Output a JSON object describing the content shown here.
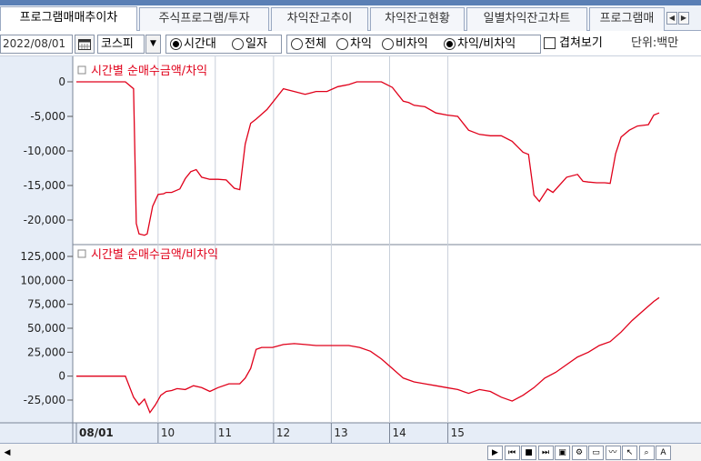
{
  "tabs": [
    {
      "label": "프로그램매매추이차",
      "active": true
    },
    {
      "label": "주식프로그램/투자",
      "active": false
    },
    {
      "label": "차익잔고추이",
      "active": false
    },
    {
      "label": "차익잔고현황",
      "active": false
    },
    {
      "label": "일별차익잔고차트",
      "active": false
    },
    {
      "label": "프로그램매",
      "active": false
    }
  ],
  "tab_scroll": {
    "left": "◀",
    "right": "▶"
  },
  "toolbar": {
    "date": "2022/08/01",
    "calendar_icon": "calendar-icon",
    "market": "코스피",
    "dropdown_arrow": "▼",
    "period_options": [
      {
        "label": "시간대",
        "selected": true
      },
      {
        "label": "일자",
        "selected": false
      }
    ],
    "type_options": [
      {
        "label": "전체",
        "selected": false
      },
      {
        "label": "차익",
        "selected": false
      },
      {
        "label": "비차익",
        "selected": false
      },
      {
        "label": "차익/비차익",
        "selected": true
      }
    ],
    "overlay_label": "겹쳐보기",
    "overlay_checked": false,
    "unit": "단위:백만"
  },
  "colors": {
    "line": "#e0001a",
    "pane_bg": "#e6edf7",
    "grid": "#c8cfda"
  },
  "chart_data": [
    {
      "type": "line",
      "title": "시간별 순매수금액/차익",
      "ylim": [
        -22000,
        0
      ],
      "yticks": [
        "0",
        "-5,000",
        "-10,000",
        "-15,000",
        "-20,000"
      ],
      "ytick_values": [
        0,
        -5000,
        -10000,
        -15000,
        -20000
      ],
      "x": [
        0,
        0.12,
        0.15,
        0.2,
        0.3,
        0.45,
        0.6,
        0.75,
        0.9,
        1.05,
        1.1,
        1.15,
        1.25,
        1.3,
        1.4,
        1.5,
        1.6,
        1.65,
        1.75,
        1.9,
        2.0,
        2.1,
        2.2,
        2.3,
        2.45,
        2.5,
        2.6,
        2.75,
        2.9,
        3.0,
        3.1,
        3.2,
        3.3,
        3.5,
        3.8,
        4.0,
        4.2,
        4.3,
        4.4,
        4.6,
        4.8,
        5.0,
        5.15,
        5.25,
        5.4,
        5.6,
        5.8,
        6.0,
        6.1,
        6.2,
        6.4,
        6.6,
        6.8,
        7.0,
        7.2,
        7.4,
        7.6,
        7.8,
        8.0,
        8.1,
        8.2,
        8.3,
        8.4,
        8.5,
        8.65,
        8.75,
        9.0,
        9.2,
        9.3,
        9.4,
        9.55,
        9.7,
        9.8,
        9.9,
        10.0,
        10.15,
        10.3,
        10.4,
        10.5,
        10.6,
        10.7
      ],
      "values": [
        0,
        0,
        0,
        0,
        0,
        0,
        0,
        0,
        0,
        -1000,
        -20500,
        -22000,
        -22200,
        -22000,
        -18000,
        -16300,
        -16200,
        -16000,
        -16000,
        -15500,
        -14000,
        -13000,
        -12700,
        -13800,
        -14100,
        -14100,
        -14100,
        -14200,
        -15400,
        -15600,
        -9000,
        -6000,
        -5400,
        -4000,
        -1000,
        -1400,
        -1800,
        -1600,
        -1400,
        -1400,
        -700,
        -400,
        0,
        0,
        0,
        0,
        -800,
        -2800,
        -3000,
        -3400,
        -3600,
        -4500,
        -4800,
        -5000,
        -7000,
        -7600,
        -7800,
        -7800,
        -8600,
        -9400,
        -10200,
        -10500,
        -16400,
        -17300,
        -15500,
        -16000,
        -13800,
        -13400,
        -14400,
        -14500,
        -14600,
        -14600,
        -14700,
        -10400,
        -8000,
        -7000,
        -6400,
        -6300,
        -6200,
        -4800,
        -4500
      ],
      "line_color": "#e0001a"
    },
    {
      "type": "line",
      "title": "시간별 순매수금액/비차익",
      "ylim": [
        -40000,
        125000
      ],
      "yticks": [
        "125,000",
        "100,000",
        "75,000",
        "50,000",
        "25,000",
        "0",
        "-25,000"
      ],
      "ytick_values": [
        125000,
        100000,
        75000,
        50000,
        25000,
        0,
        -25000
      ],
      "x": [
        0,
        0.3,
        0.6,
        0.9,
        1.05,
        1.15,
        1.25,
        1.35,
        1.45,
        1.55,
        1.65,
        1.75,
        1.85,
        2.0,
        2.15,
        2.3,
        2.45,
        2.6,
        2.8,
        3.0,
        3.1,
        3.2,
        3.3,
        3.4,
        3.6,
        3.8,
        4.0,
        4.2,
        4.4,
        4.6,
        4.8,
        5.0,
        5.2,
        5.4,
        5.6,
        5.8,
        6.0,
        6.2,
        6.4,
        6.6,
        6.8,
        7.0,
        7.2,
        7.4,
        7.6,
        7.8,
        8.0,
        8.2,
        8.4,
        8.6,
        8.8,
        9.0,
        9.2,
        9.4,
        9.6,
        9.8,
        10.0,
        10.2,
        10.4,
        10.6,
        10.7
      ],
      "values": [
        0,
        0,
        0,
        0,
        -22000,
        -30000,
        -24000,
        -38000,
        -30000,
        -20000,
        -16000,
        -15000,
        -13000,
        -14000,
        -10000,
        -12000,
        -16000,
        -12000,
        -8000,
        -8000,
        -2000,
        8000,
        28000,
        30000,
        30000,
        33000,
        34000,
        33000,
        32000,
        32000,
        32000,
        32000,
        30000,
        26000,
        18000,
        8000,
        -2000,
        -6000,
        -8000,
        -10000,
        -12000,
        -14000,
        -18000,
        -14000,
        -16000,
        -22000,
        -26000,
        -20000,
        -12000,
        -2000,
        4000,
        12000,
        20000,
        25000,
        32000,
        36000,
        46000,
        58000,
        68000,
        78000,
        82000
      ],
      "line_color": "#e0001a"
    }
  ],
  "x_axis": {
    "labels": [
      {
        "text": "08/01",
        "x": 0,
        "bold": true
      },
      {
        "text": "10",
        "x": 1.5,
        "bold": false
      },
      {
        "text": "11",
        "x": 2.55,
        "bold": false
      },
      {
        "text": "12",
        "x": 3.62,
        "bold": false
      },
      {
        "text": "13",
        "x": 4.68,
        "bold": false
      },
      {
        "text": "14",
        "x": 5.75,
        "bold": false
      },
      {
        "text": "15",
        "x": 6.82,
        "bold": false
      }
    ]
  },
  "bottom_buttons": [
    {
      "name": "play-icon",
      "glyph": "▶"
    },
    {
      "name": "rewind-icon",
      "glyph": "⏮"
    },
    {
      "name": "stop-icon",
      "glyph": "■"
    },
    {
      "name": "forward-icon",
      "glyph": "⏭"
    },
    {
      "name": "chart-copy-icon",
      "glyph": "▣"
    },
    {
      "name": "settings-icon",
      "glyph": "⚙"
    },
    {
      "name": "window-icon",
      "glyph": "▭"
    },
    {
      "name": "graph-icon",
      "glyph": "〰"
    },
    {
      "name": "cursor-icon",
      "glyph": "↖"
    },
    {
      "name": "zoom-icon",
      "glyph": "⌕"
    },
    {
      "name": "text-icon",
      "glyph": "A"
    }
  ],
  "scroll_left": "◀"
}
